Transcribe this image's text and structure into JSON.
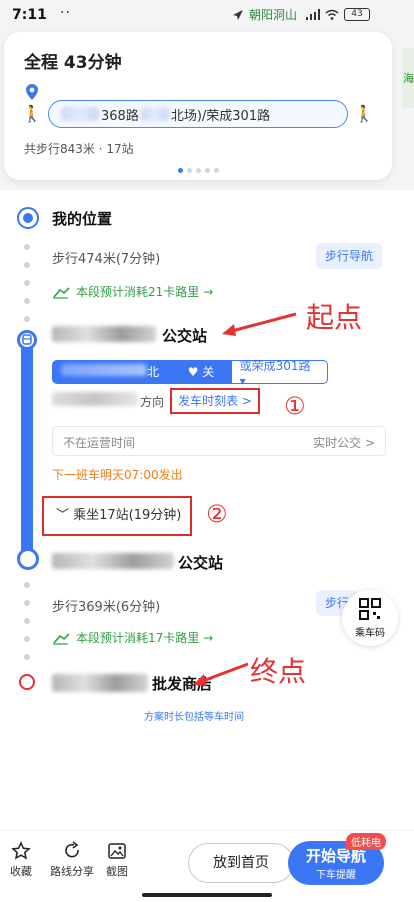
{
  "status_bar": {
    "time": "7:11",
    "dots": "··",
    "place": "朝阳洞山",
    "battery": "43"
  },
  "map_edge_text": "海",
  "summary": {
    "title": "全程  43分钟",
    "route_label": "368路",
    "route_label_2": "北场)/荣成301路",
    "meta": "共步行843米 · 17站"
  },
  "steps": {
    "origin": "我的位置",
    "walk1": "步行474米(7分钟)",
    "walk_nav": "步行导航",
    "cal1": "本段预计消耗21卡路里 →",
    "board_station_suffix": "公交站",
    "bus_line_main": "北场)",
    "follow": "♥ 关注",
    "alt_line": "或荣成301路 ▾",
    "direction": "方向",
    "timetable": "发车时刻表 >",
    "not_running": "不在运营时间",
    "realtime": "实时公交 >",
    "next_bus": "下一班车明天07:00发出",
    "ride": "﹀ 乘坐17站(19分钟)",
    "alight_station_suffix": "公交站",
    "walk2": "步行369米(6分钟)",
    "walk_nav_2": "步行",
    "cal2": "本段预计消耗17卡路里 →",
    "destination_suffix": "批发商店",
    "footnote": "方案时长包括等车时间",
    "qr_label": "乘车码"
  },
  "annotations": {
    "start_label": "起点",
    "end_label": "终点",
    "num1": "①",
    "num2": "②"
  },
  "toolbar": {
    "favorite": "收藏",
    "share": "路线分享",
    "screenshot": "截图",
    "home": "放到首页",
    "start": "开始导航",
    "start_sub": "下车提醒",
    "low_power": "低耗电"
  },
  "colors": {
    "accent": "#3b76f5",
    "green": "#2ea045",
    "annotation_red": "#e53232"
  }
}
